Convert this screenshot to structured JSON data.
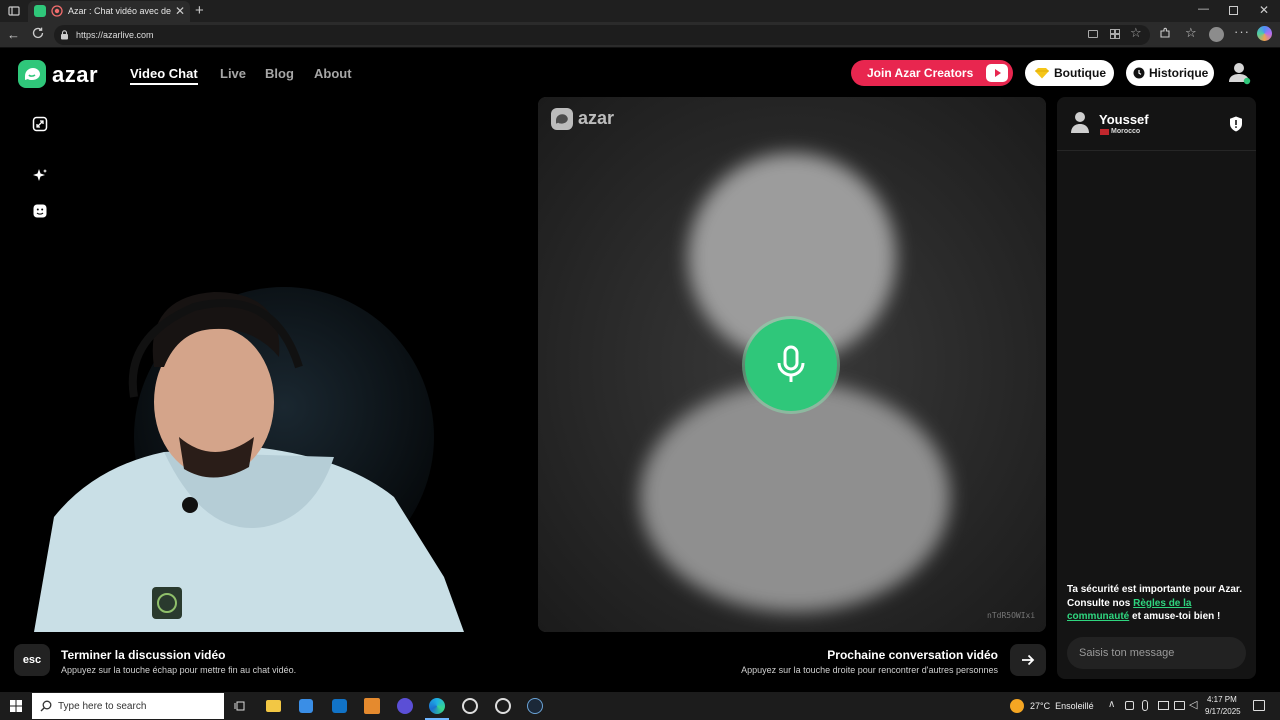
{
  "browser": {
    "tab_title": "Azar : Chat vidéo avec de no",
    "url": "https://azarlive.com"
  },
  "nav": {
    "logo_text": "azar",
    "links": [
      "Video Chat",
      "Live",
      "Blog",
      "About"
    ],
    "join_creators": "Join Azar Creators",
    "boutique": "Boutique",
    "historique": "Historique"
  },
  "remote": {
    "watermark_logo": "azar",
    "id_code": "nTdR5OWIxi"
  },
  "chat": {
    "user_name": "Youssef",
    "country": "Morocco",
    "safety_text_1": "Ta sécurité est importante pour Azar. Consulte nos ",
    "safety_link": "Règles de la communauté",
    "safety_text_2": " et amuse-toi bien !",
    "message_placeholder": "Saisis ton message"
  },
  "bottom": {
    "esc_key": "esc",
    "end_title": "Terminer la discussion vidéo",
    "end_sub": "Appuyez sur la touche échap pour mettre fin au chat vidéo.",
    "next_title": "Prochaine conversation vidéo",
    "next_sub": "Appuyez sur la touche droite pour rencontrer d'autres personnes"
  },
  "taskbar": {
    "search_placeholder": "Type here to search",
    "weather": "27°C  Ensoleillé",
    "time": "4:17 PM",
    "date": "9/17/2025"
  },
  "colors": {
    "brand_green": "#2fc77a",
    "creators_red": "#e8264f",
    "link_green": "#2fd67f"
  }
}
